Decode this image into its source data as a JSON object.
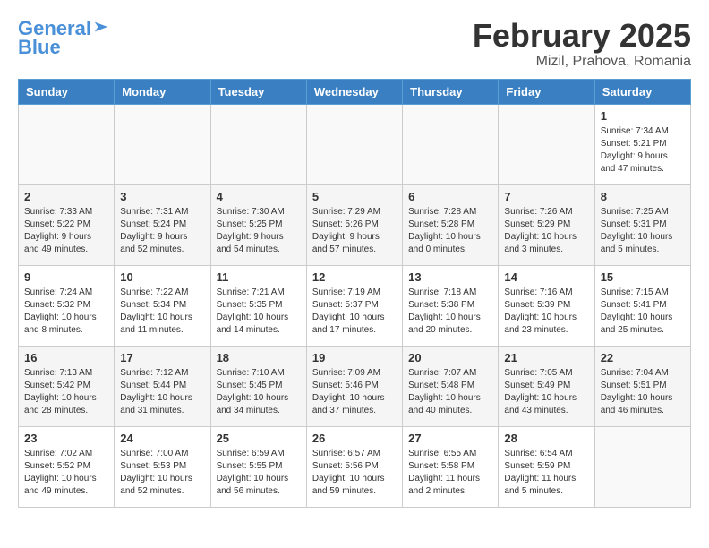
{
  "header": {
    "logo_general": "General",
    "logo_blue": "Blue",
    "month": "February 2025",
    "location": "Mizil, Prahova, Romania"
  },
  "days_of_week": [
    "Sunday",
    "Monday",
    "Tuesday",
    "Wednesday",
    "Thursday",
    "Friday",
    "Saturday"
  ],
  "weeks": [
    [
      {
        "day": "",
        "info": ""
      },
      {
        "day": "",
        "info": ""
      },
      {
        "day": "",
        "info": ""
      },
      {
        "day": "",
        "info": ""
      },
      {
        "day": "",
        "info": ""
      },
      {
        "day": "",
        "info": ""
      },
      {
        "day": "1",
        "info": "Sunrise: 7:34 AM\nSunset: 5:21 PM\nDaylight: 9 hours and 47 minutes."
      }
    ],
    [
      {
        "day": "2",
        "info": "Sunrise: 7:33 AM\nSunset: 5:22 PM\nDaylight: 9 hours and 49 minutes."
      },
      {
        "day": "3",
        "info": "Sunrise: 7:31 AM\nSunset: 5:24 PM\nDaylight: 9 hours and 52 minutes."
      },
      {
        "day": "4",
        "info": "Sunrise: 7:30 AM\nSunset: 5:25 PM\nDaylight: 9 hours and 54 minutes."
      },
      {
        "day": "5",
        "info": "Sunrise: 7:29 AM\nSunset: 5:26 PM\nDaylight: 9 hours and 57 minutes."
      },
      {
        "day": "6",
        "info": "Sunrise: 7:28 AM\nSunset: 5:28 PM\nDaylight: 10 hours and 0 minutes."
      },
      {
        "day": "7",
        "info": "Sunrise: 7:26 AM\nSunset: 5:29 PM\nDaylight: 10 hours and 3 minutes."
      },
      {
        "day": "8",
        "info": "Sunrise: 7:25 AM\nSunset: 5:31 PM\nDaylight: 10 hours and 5 minutes."
      }
    ],
    [
      {
        "day": "9",
        "info": "Sunrise: 7:24 AM\nSunset: 5:32 PM\nDaylight: 10 hours and 8 minutes."
      },
      {
        "day": "10",
        "info": "Sunrise: 7:22 AM\nSunset: 5:34 PM\nDaylight: 10 hours and 11 minutes."
      },
      {
        "day": "11",
        "info": "Sunrise: 7:21 AM\nSunset: 5:35 PM\nDaylight: 10 hours and 14 minutes."
      },
      {
        "day": "12",
        "info": "Sunrise: 7:19 AM\nSunset: 5:37 PM\nDaylight: 10 hours and 17 minutes."
      },
      {
        "day": "13",
        "info": "Sunrise: 7:18 AM\nSunset: 5:38 PM\nDaylight: 10 hours and 20 minutes."
      },
      {
        "day": "14",
        "info": "Sunrise: 7:16 AM\nSunset: 5:39 PM\nDaylight: 10 hours and 23 minutes."
      },
      {
        "day": "15",
        "info": "Sunrise: 7:15 AM\nSunset: 5:41 PM\nDaylight: 10 hours and 25 minutes."
      }
    ],
    [
      {
        "day": "16",
        "info": "Sunrise: 7:13 AM\nSunset: 5:42 PM\nDaylight: 10 hours and 28 minutes."
      },
      {
        "day": "17",
        "info": "Sunrise: 7:12 AM\nSunset: 5:44 PM\nDaylight: 10 hours and 31 minutes."
      },
      {
        "day": "18",
        "info": "Sunrise: 7:10 AM\nSunset: 5:45 PM\nDaylight: 10 hours and 34 minutes."
      },
      {
        "day": "19",
        "info": "Sunrise: 7:09 AM\nSunset: 5:46 PM\nDaylight: 10 hours and 37 minutes."
      },
      {
        "day": "20",
        "info": "Sunrise: 7:07 AM\nSunset: 5:48 PM\nDaylight: 10 hours and 40 minutes."
      },
      {
        "day": "21",
        "info": "Sunrise: 7:05 AM\nSunset: 5:49 PM\nDaylight: 10 hours and 43 minutes."
      },
      {
        "day": "22",
        "info": "Sunrise: 7:04 AM\nSunset: 5:51 PM\nDaylight: 10 hours and 46 minutes."
      }
    ],
    [
      {
        "day": "23",
        "info": "Sunrise: 7:02 AM\nSunset: 5:52 PM\nDaylight: 10 hours and 49 minutes."
      },
      {
        "day": "24",
        "info": "Sunrise: 7:00 AM\nSunset: 5:53 PM\nDaylight: 10 hours and 52 minutes."
      },
      {
        "day": "25",
        "info": "Sunrise: 6:59 AM\nSunset: 5:55 PM\nDaylight: 10 hours and 56 minutes."
      },
      {
        "day": "26",
        "info": "Sunrise: 6:57 AM\nSunset: 5:56 PM\nDaylight: 10 hours and 59 minutes."
      },
      {
        "day": "27",
        "info": "Sunrise: 6:55 AM\nSunset: 5:58 PM\nDaylight: 11 hours and 2 minutes."
      },
      {
        "day": "28",
        "info": "Sunrise: 6:54 AM\nSunset: 5:59 PM\nDaylight: 11 hours and 5 minutes."
      },
      {
        "day": "",
        "info": ""
      }
    ]
  ]
}
